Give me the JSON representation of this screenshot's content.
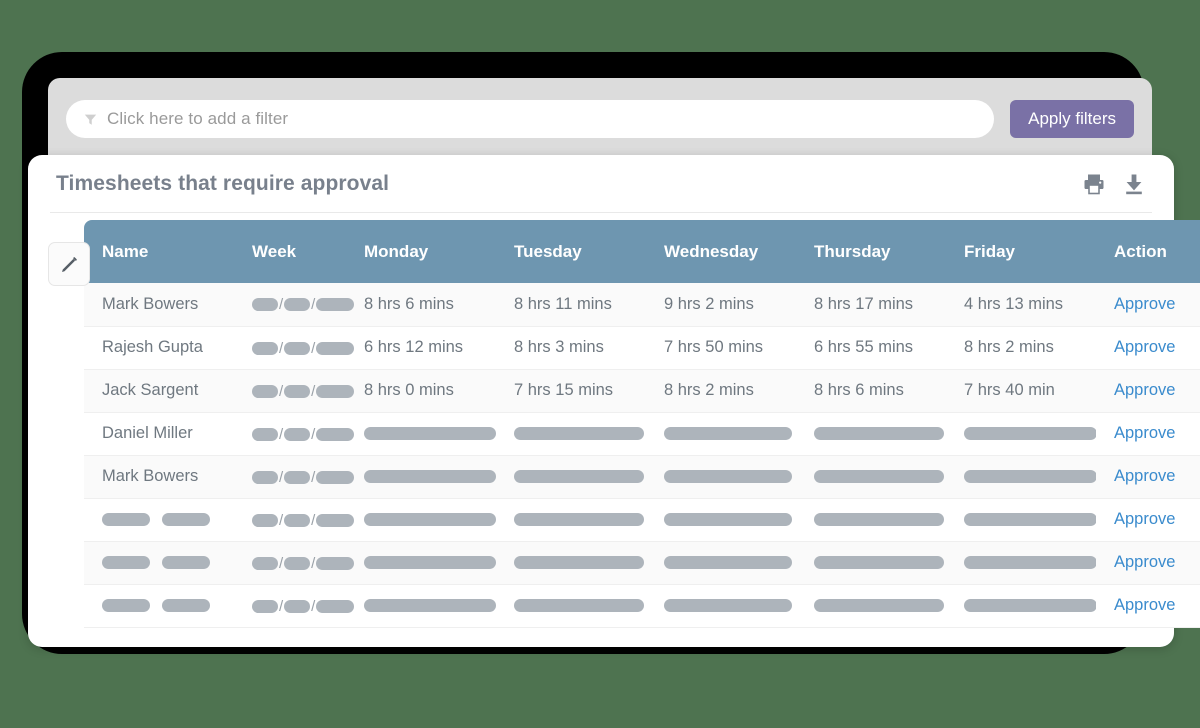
{
  "theme": {
    "background": "#4e7350",
    "bezel": "#000000",
    "filter_panel": "#dcdcdc",
    "accent_button": "#7a71a6",
    "table_header": "#6e96b0",
    "link": "#3a8bcd",
    "title_text": "#78808c",
    "body_text": "#6f7880",
    "redaction": "#adb4bb"
  },
  "filter_bar": {
    "icon": "funnel-icon",
    "placeholder": "Click here to add a filter",
    "value": "",
    "apply_label": "Apply filters"
  },
  "card": {
    "title": "Timesheets that require approval",
    "icons": [
      "print-icon",
      "download-icon"
    ],
    "edit_icon": "pencil-icon"
  },
  "table": {
    "columns": [
      "Name",
      "Week",
      "Monday",
      "Tuesday",
      "Wednesday",
      "Thursday",
      "Friday",
      "Action"
    ],
    "action_label": "Approve",
    "rows": [
      {
        "name": "Mark Bowers",
        "name_redacted": false,
        "week": "redacted",
        "monday": "8 hrs 6 mins",
        "tuesday": "8 hrs 11 mins",
        "wednesday": "9 hrs 2 mins",
        "thursday": "8 hrs 17 mins",
        "friday": "4 hrs 13 mins",
        "days_redacted": false
      },
      {
        "name": "Rajesh Gupta",
        "name_redacted": false,
        "week": "redacted",
        "monday": "6 hrs 12 mins",
        "tuesday": "8 hrs 3 mins",
        "wednesday": "7 hrs 50 mins",
        "thursday": "6 hrs 55 mins",
        "friday": "8 hrs 2 mins",
        "days_redacted": false
      },
      {
        "name": "Jack Sargent",
        "name_redacted": false,
        "week": "redacted",
        "monday": "8 hrs 0 mins",
        "tuesday": "7 hrs 15 mins",
        "wednesday": "8 hrs 2 mins",
        "thursday": "8 hrs 6 mins",
        "friday": "7 hrs 40 min",
        "days_redacted": false
      },
      {
        "name": "Daniel Miller",
        "name_redacted": false,
        "week": "redacted",
        "monday": "",
        "tuesday": "",
        "wednesday": "",
        "thursday": "",
        "friday": "",
        "days_redacted": true
      },
      {
        "name": "Mark Bowers",
        "name_redacted": false,
        "week": "redacted",
        "monday": "",
        "tuesday": "",
        "wednesday": "",
        "thursday": "",
        "friday": "",
        "days_redacted": true
      },
      {
        "name": "",
        "name_redacted": true,
        "week": "redacted",
        "monday": "",
        "tuesday": "",
        "wednesday": "",
        "thursday": "",
        "friday": "",
        "days_redacted": true
      },
      {
        "name": "",
        "name_redacted": true,
        "week": "redacted",
        "monday": "",
        "tuesday": "",
        "wednesday": "",
        "thursday": "",
        "friday": "",
        "days_redacted": true
      },
      {
        "name": "",
        "name_redacted": true,
        "week": "redacted",
        "monday": "",
        "tuesday": "",
        "wednesday": "",
        "thursday": "",
        "friday": "",
        "days_redacted": true
      }
    ]
  }
}
